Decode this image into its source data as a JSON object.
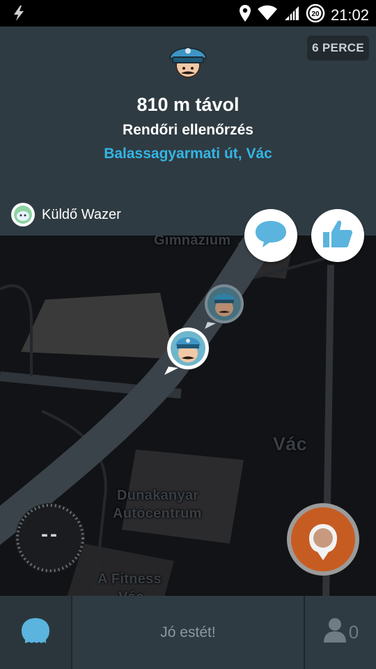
{
  "status_bar": {
    "time": "21:02",
    "notification_count": "20",
    "icons": [
      "lightning-icon",
      "location-pin-icon",
      "wifi-icon",
      "signal-icon"
    ]
  },
  "alert": {
    "timer": "6 PERCE",
    "distance": "810 m távol",
    "type": "Rendőri ellenőrzés",
    "street": "Balassagyarmati út, Vác",
    "reporter": "Küldő Wazer",
    "street_color": "#33b5e5"
  },
  "map": {
    "labels": {
      "gimnazium": "Gimnázium",
      "vac": "Vác",
      "dunakanyar_line1": "Dunakanyar",
      "dunakanyar_line2": "Autócentrum",
      "fitness_line1": "A Fitness",
      "fitness_line2": "Vác"
    }
  },
  "speedometer": {
    "value": "--"
  },
  "bottom_bar": {
    "greeting": "Jó estét!",
    "friends_count": "0"
  },
  "colors": {
    "card_bg": "#2f3b42",
    "report_button": "#c75c22",
    "road": "#3b434a"
  }
}
